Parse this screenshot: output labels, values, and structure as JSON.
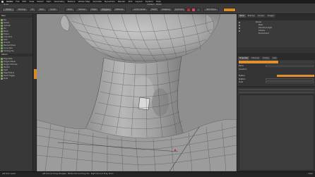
{
  "menubar": {
    "app": "modo",
    "items": [
      "File",
      "Edit",
      "View",
      "Select",
      "Item",
      "Geometry",
      "Texture",
      "Vertex Map",
      "Animate",
      "Dynamics",
      "Render",
      "ACS",
      "Layout",
      "System",
      "Help"
    ]
  },
  "window": {
    "title": "Untitled* - MODO",
    "left_info": "Model"
  },
  "toolbar": {
    "buttons": [
      "Model",
      "Topology",
      "UV",
      "Paint",
      "Sculpt",
      "Items",
      "Vertices",
      "Edges",
      "Polygons",
      "Materials",
      "Action Center",
      "Falloff",
      "Snapping",
      "Symmetry",
      "Work Plane"
    ]
  },
  "left_panel": {
    "header": "Basic",
    "items": [
      "Box",
      "Sphere",
      "Cylinder",
      "Pen",
      "Bevel",
      "Extend",
      "Loop Slice",
      "Push",
      "Smooth",
      "Element Move",
      "Curve Slice",
      "Tracking Tool",
      "Edge Slide",
      "Polygon Bevel",
      "Polygon Extrude",
      "Stretch",
      "Twist",
      "Edge Extend",
      "Sub-D Toggle",
      "Knife"
    ],
    "section2": "Deform"
  },
  "right_panel": {
    "tabs_top": [
      "Items",
      "Shading",
      "Groups",
      "Images"
    ],
    "items": [
      "Render",
      "Mesh",
      "Directional Light",
      "Camera",
      "Environment"
    ],
    "tabs_mid": [
      "Properties",
      "Channels",
      "Display",
      "Lists"
    ],
    "props": [
      "Name",
      "Transform",
      "Position",
      "Rotation",
      "Scale",
      "Reset",
      "Zero",
      "Add"
    ]
  },
  "status": {
    "left": "Left Click: Select",
    "main": "Left Click and Drag: Navigate · Middle Click and Drag: Pan · Right Click and Drag: Zoom",
    "right": "1 Item"
  },
  "colors": {
    "accent": "#e0902e",
    "viewport_bg": "#8f8f8f",
    "panel_bg": "#343434"
  }
}
